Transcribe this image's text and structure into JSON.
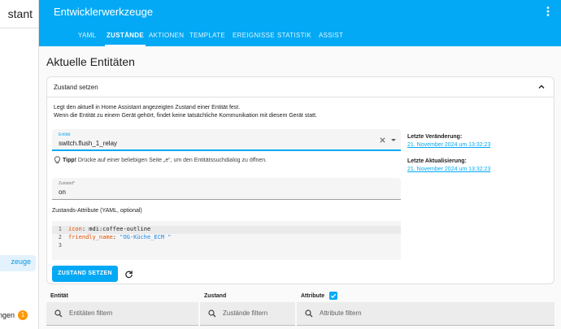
{
  "sidebar": {
    "title": "stant",
    "active_item": "zeuge",
    "notif_item": "ngen",
    "notif_count": "1"
  },
  "header": {
    "title": "Entwicklerwerkzeuge",
    "tabs": [
      {
        "label": "YAML"
      },
      {
        "label": "ZUSTÄNDE"
      },
      {
        "label": "AKTIONEN"
      },
      {
        "label": "TEMPLATE"
      },
      {
        "label": "EREIGNISSE"
      },
      {
        "label": "STATISTIK"
      },
      {
        "label": "ASSIST"
      }
    ],
    "active_tab": "ZUSTÄNDE"
  },
  "main": {
    "page_title": "Aktuelle Entitäten",
    "card": {
      "title": "Zustand setzen",
      "desc1": "Legt den aktuell in Home Assistant angezeigten Zustand einer Entität fest.",
      "desc2": "Wenn die Entität zu einem Gerät gehört, findet keine tatsächliche Kommunikation mit diesem Gerät statt.",
      "entity_label": "Entität",
      "entity_value": "switch.flush_1_relay",
      "tip_bold": "Tipp!",
      "tip_text": " Drücke auf einer beliebigen Seite „e“, um den Entitätssuchdialog zu öffnen.",
      "state_label": "Zustand*",
      "state_value": "on",
      "attr_label": "Zustands-Attribute (YAML, optional)",
      "code": [
        {
          "num": "1",
          "key": "icon",
          "value": "mdi:coffee-outline"
        },
        {
          "num": "2",
          "key": "friendly_name",
          "value": "\"OG-Küche_ECM \""
        },
        {
          "num": "3",
          "key": "",
          "value": ""
        }
      ],
      "set_button": "ZUSTAND SETZEN",
      "last_changed_label": "Letzte Veränderung:",
      "last_changed_value": "21. November 2024 um 13:32:23",
      "last_updated_label": "Letzte Aktualisierung:",
      "last_updated_value": "21. November 2024 um 13:32:23"
    },
    "table": {
      "col_entity": "Entität",
      "col_state": "Zustand",
      "col_attributes": "Attribute",
      "filter_entity": "Entitäten filtern",
      "filter_state": "Zustände filtern",
      "filter_attributes": "Attribute filtern"
    }
  },
  "colors": {
    "primary": "#03a9f4",
    "badge": "#ff9800"
  },
  "icons": [
    "dots-vertical-icon",
    "chevron-up-icon",
    "close-icon",
    "dropdown-icon",
    "lightbulb-icon",
    "refresh-icon",
    "search-icon",
    "checkbox-icon"
  ]
}
